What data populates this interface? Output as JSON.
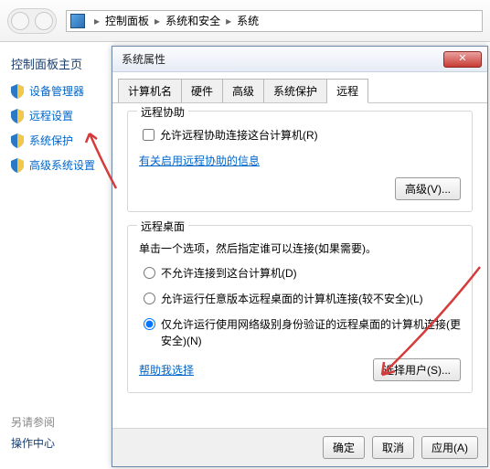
{
  "breadcrumb": {
    "a": "控制面板",
    "b": "系统和安全",
    "c": "系统"
  },
  "sidebar": {
    "title": "控制面板主页",
    "items": [
      "设备管理器",
      "远程设置",
      "系统保护",
      "高级系统设置"
    ]
  },
  "see_also": {
    "title": "另请参阅",
    "item": "操作中心"
  },
  "dialog": {
    "title": "系统属性",
    "tabs": [
      "计算机名",
      "硬件",
      "高级",
      "系统保护",
      "远程"
    ],
    "ra": {
      "group": "远程协助",
      "checkbox": "允许远程协助连接这台计算机(R)",
      "link": "有关启用远程协助的信息",
      "btn": "高级(V)..."
    },
    "rd": {
      "group": "远程桌面",
      "desc": "单击一个选项，然后指定谁可以连接(如果需要)。",
      "r1": "不允许连接到这台计算机(D)",
      "r2": "允许运行任意版本远程桌面的计算机连接(较不安全)(L)",
      "r3": "仅允许运行使用网络级别身份验证的远程桌面的计算机连接(更安全)(N)",
      "help": "帮助我选择",
      "select": "选择用户(S)..."
    },
    "btns": {
      "ok": "确定",
      "cancel": "取消",
      "apply": "应用(A)"
    }
  }
}
